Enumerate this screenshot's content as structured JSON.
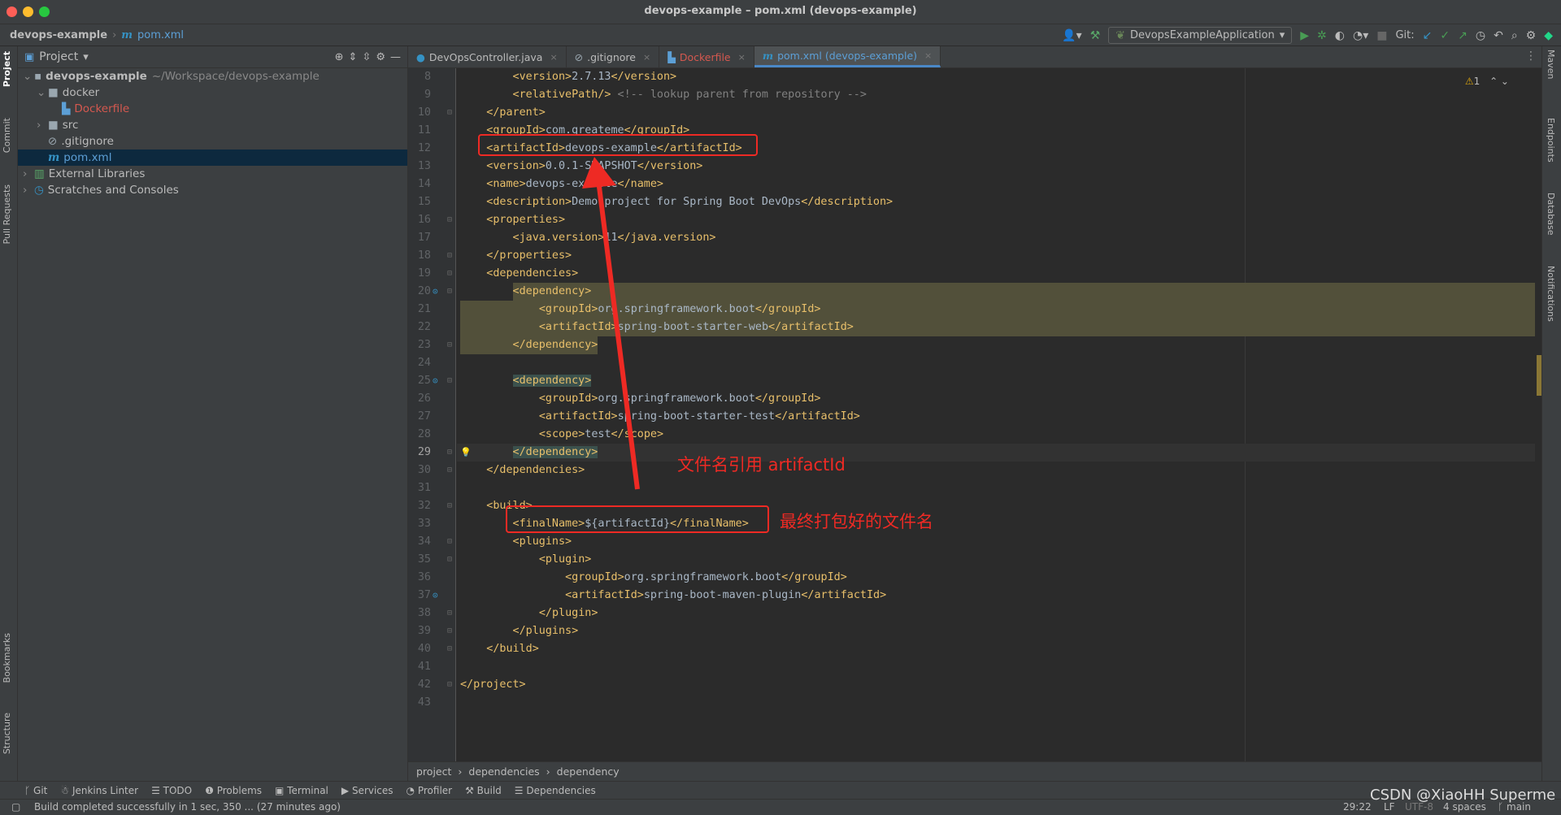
{
  "window": {
    "title": "devops-example – pom.xml (devops-example)"
  },
  "navbar": {
    "project": "devops-example",
    "file": "pom.xml"
  },
  "toolbar": {
    "run_config": "DevopsExampleApplication",
    "git_label": "Git:"
  },
  "left_stripe": [
    "Project",
    "Commit",
    "Pull Requests",
    "Bookmarks",
    "Structure"
  ],
  "right_stripe": [
    "Maven",
    "Endpoints",
    "Database",
    "Notifications"
  ],
  "project_panel": {
    "title": "Project",
    "tree": [
      {
        "label": "devops-example",
        "hint": "~/Workspace/devops-example",
        "depth": 0,
        "expanded": true,
        "icon": "module-icon",
        "bold": true
      },
      {
        "label": "docker",
        "depth": 1,
        "expanded": true,
        "icon": "folder-icon"
      },
      {
        "label": "Dockerfile",
        "depth": 2,
        "icon": "docker-file-icon",
        "color": "#d5584f"
      },
      {
        "label": "src",
        "depth": 1,
        "expanded": false,
        "icon": "folder-icon"
      },
      {
        "label": ".gitignore",
        "depth": 1,
        "icon": "ignore-file-icon"
      },
      {
        "label": "pom.xml",
        "depth": 1,
        "icon": "maven-icon",
        "selected": true,
        "color": "#5c9fd6"
      },
      {
        "label": "External Libraries",
        "depth": 0,
        "expanded": false,
        "icon": "library-icon"
      },
      {
        "label": "Scratches and Consoles",
        "depth": 0,
        "expanded": false,
        "icon": "scratches-icon"
      }
    ]
  },
  "tabs": [
    {
      "label": "DevOpsController.java",
      "icon": "java-class-icon"
    },
    {
      "label": ".gitignore",
      "icon": "ignore-file-icon"
    },
    {
      "label": "Dockerfile",
      "icon": "docker-file-icon",
      "color": "#d5584f"
    },
    {
      "label": "pom.xml (devops-example)",
      "icon": "maven-icon",
      "active": true
    }
  ],
  "inspections": {
    "warnings": "1"
  },
  "code_lines": [
    {
      "n": "8",
      "indent": 2,
      "text": "<version>2.7.13</version>"
    },
    {
      "n": "9",
      "indent": 2,
      "text": "<relativePath/> <!-- lookup parent from repository -->"
    },
    {
      "n": "10",
      "indent": 1,
      "text": "</parent>"
    },
    {
      "n": "11",
      "indent": 1,
      "text": "<groupId>com.greateme</groupId>"
    },
    {
      "n": "12",
      "indent": 1,
      "text": "<artifactId>devops-example</artifactId>"
    },
    {
      "n": "13",
      "indent": 1,
      "text": "<version>0.0.1-SNAPSHOT</version>"
    },
    {
      "n": "14",
      "indent": 1,
      "text": "<name>devops-example</name>"
    },
    {
      "n": "15",
      "indent": 1,
      "text": "<description>Demo project for Spring Boot DevOps</description>"
    },
    {
      "n": "16",
      "indent": 1,
      "text": "<properties>"
    },
    {
      "n": "17",
      "indent": 2,
      "text": "<java.version>11</java.version>"
    },
    {
      "n": "18",
      "indent": 1,
      "text": "</properties>"
    },
    {
      "n": "19",
      "indent": 1,
      "text": "<dependencies>"
    },
    {
      "n": "20",
      "indent": 2,
      "text": "<dependency>"
    },
    {
      "n": "21",
      "indent": 3,
      "text": "<groupId>org.springframework.boot</groupId>"
    },
    {
      "n": "22",
      "indent": 3,
      "text": "<artifactId>spring-boot-starter-web</artifactId>"
    },
    {
      "n": "23",
      "indent": 2,
      "text": "</dependency>"
    },
    {
      "n": "24",
      "indent": 0,
      "text": ""
    },
    {
      "n": "25",
      "indent": 2,
      "text": "<dependency>"
    },
    {
      "n": "26",
      "indent": 3,
      "text": "<groupId>org.springframework.boot</groupId>"
    },
    {
      "n": "27",
      "indent": 3,
      "text": "<artifactId>spring-boot-starter-test</artifactId>"
    },
    {
      "n": "28",
      "indent": 3,
      "text": "<scope>test</scope>"
    },
    {
      "n": "29",
      "indent": 2,
      "text": "</dependency>"
    },
    {
      "n": "30",
      "indent": 1,
      "text": "</dependencies>"
    },
    {
      "n": "31",
      "indent": 0,
      "text": ""
    },
    {
      "n": "32",
      "indent": 1,
      "text": "<build>"
    },
    {
      "n": "33",
      "indent": 2,
      "text": "<finalName>${artifactId}</finalName>"
    },
    {
      "n": "34",
      "indent": 2,
      "text": "<plugins>"
    },
    {
      "n": "35",
      "indent": 3,
      "text": "<plugin>"
    },
    {
      "n": "36",
      "indent": 4,
      "text": "<groupId>org.springframework.boot</groupId>"
    },
    {
      "n": "37",
      "indent": 4,
      "text": "<artifactId>spring-boot-maven-plugin</artifactId>"
    },
    {
      "n": "38",
      "indent": 3,
      "text": "</plugin>"
    },
    {
      "n": "39",
      "indent": 2,
      "text": "</plugins>"
    },
    {
      "n": "40",
      "indent": 1,
      "text": "</build>"
    },
    {
      "n": "41",
      "indent": 0,
      "text": ""
    },
    {
      "n": "42",
      "indent": 0,
      "text": "</project>"
    },
    {
      "n": "43",
      "indent": 0,
      "text": ""
    }
  ],
  "breadcrumb": [
    "project",
    "dependencies",
    "dependency"
  ],
  "tool_windows": [
    "Git",
    "Jenkins Linter",
    "TODO",
    "Problems",
    "Terminal",
    "Services",
    "Profiler",
    "Build",
    "Dependencies"
  ],
  "status": {
    "message": "Build completed successfully in 1 sec, 350 ... (27 minutes ago)",
    "position": "29:22",
    "line_sep": "LF",
    "encoding": "UTF-8",
    "indent": "4 spaces",
    "branch": "main"
  },
  "annotations": {
    "artifact_note": "文件名引用 artifactId",
    "finalname_note": "最终打包好的文件名",
    "color": "#ee2a24"
  },
  "watermark": "CSDN @XiaoHH Superme"
}
